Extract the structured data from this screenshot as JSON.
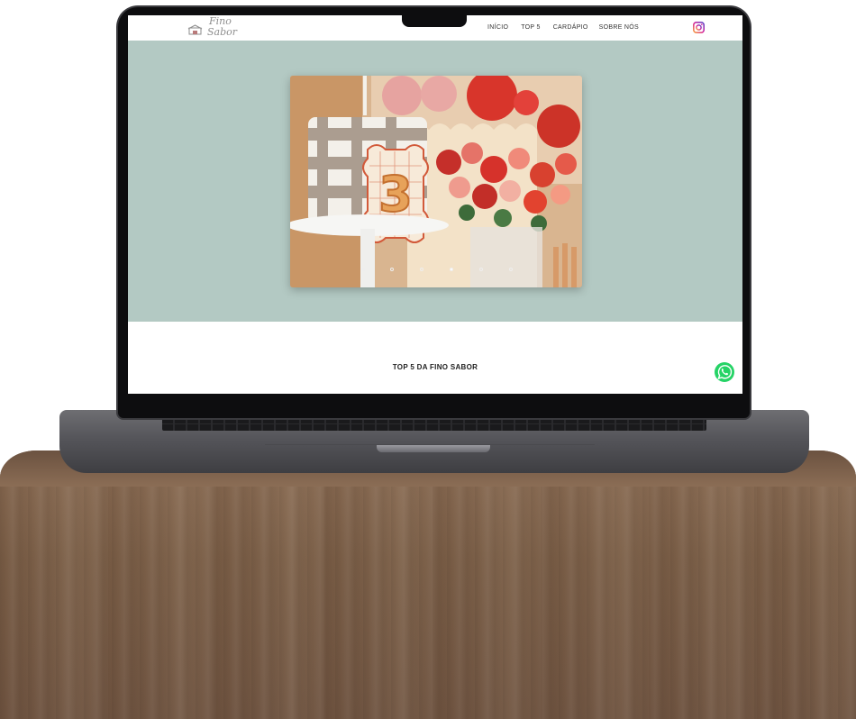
{
  "header": {
    "logo_line1": "Fino",
    "logo_line2": "Sabor",
    "nav": [
      "INÍCIO",
      "TOP 5",
      "CARDÁPIO",
      "SOBRE NÓS"
    ]
  },
  "hero": {
    "slide_count": 6,
    "active_slide": 4,
    "cake_number": "3"
  },
  "section": {
    "title": "TOP 5 DA FINO SABOR"
  },
  "icons": {
    "logo": "house-logo-icon",
    "social": "instagram-icon",
    "chat": "whatsapp-icon"
  },
  "colors": {
    "hero_background": "#b3c9c3",
    "whatsapp": "#25d366",
    "instagram": "#d6249f"
  }
}
